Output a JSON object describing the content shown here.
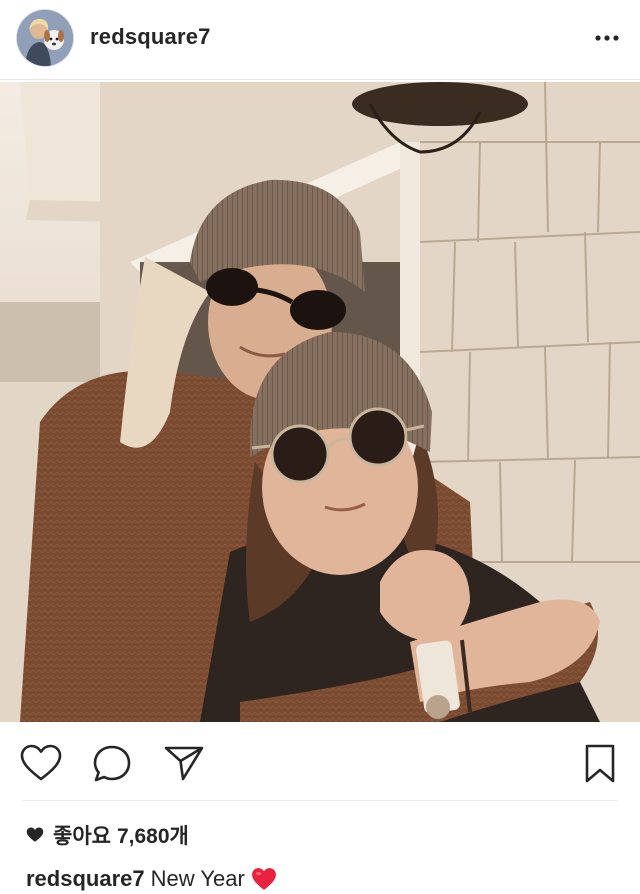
{
  "post": {
    "username": "redsquare7",
    "avatar_icon": "user-with-dog-avatar",
    "more_icon": "ellipsis-icon",
    "image": {
      "alt": "Two people in beanies and sunglasses hugging on a porch",
      "tone": "sepia"
    },
    "actions": [
      {
        "name": "like",
        "icon": "heart-outline-icon"
      },
      {
        "name": "comment",
        "icon": "speech-bubble-icon"
      },
      {
        "name": "share",
        "icon": "paper-plane-icon"
      },
      {
        "name": "save",
        "icon": "bookmark-icon"
      }
    ],
    "likes": {
      "label": "좋아요",
      "count": "7,680개"
    },
    "caption": {
      "username": "redsquare7",
      "text": "New Year",
      "emoji": "red-heart-emoji"
    }
  },
  "colors": {
    "text": "#262626",
    "divider": "#ececec",
    "heart_red": "#e8223c"
  }
}
